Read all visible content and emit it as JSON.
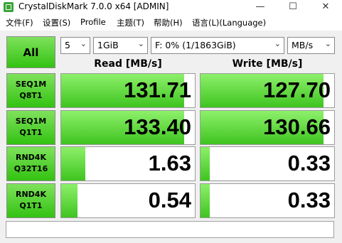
{
  "window": {
    "title": "CrystalDiskMark 7.0.0 x64 [ADMIN]",
    "minimize_glyph": "—",
    "maximize_glyph": "☐",
    "close_glyph": "✕"
  },
  "menu": [
    "文件(F)",
    "设置(S)",
    "Profile",
    "主题(T)",
    "帮助(H)",
    "语言(L)(Language)"
  ],
  "controls": {
    "all_label": "All",
    "count": "5",
    "size": "1GiB",
    "drive": "F: 0% (1/1863GiB)",
    "unit": "MB/s",
    "chevron": "⌄"
  },
  "headers": {
    "read": "Read [MB/s]",
    "write": "Write [MB/s]"
  },
  "tests": [
    {
      "line1": "SEQ1M",
      "line2": "Q8T1",
      "read": "131.71",
      "write": "127.70",
      "read_fill": 0.92,
      "write_fill": 0.92
    },
    {
      "line1": "SEQ1M",
      "line2": "Q1T1",
      "read": "133.40",
      "write": "130.66",
      "read_fill": 0.92,
      "write_fill": 0.92
    },
    {
      "line1": "RND4K",
      "line2": "Q32T16",
      "read": "1.63",
      "write": "0.33",
      "read_fill": 0.18,
      "write_fill": 0.07
    },
    {
      "line1": "RND4K",
      "line2": "Q1T1",
      "read": "0.54",
      "write": "0.33",
      "read_fill": 0.12,
      "write_fill": 0.07
    }
  ],
  "colors": {
    "accent_top": "#8df06a",
    "accent_bottom": "#3fc420",
    "button_top": "#7fe25c",
    "button_bottom": "#33c212"
  }
}
